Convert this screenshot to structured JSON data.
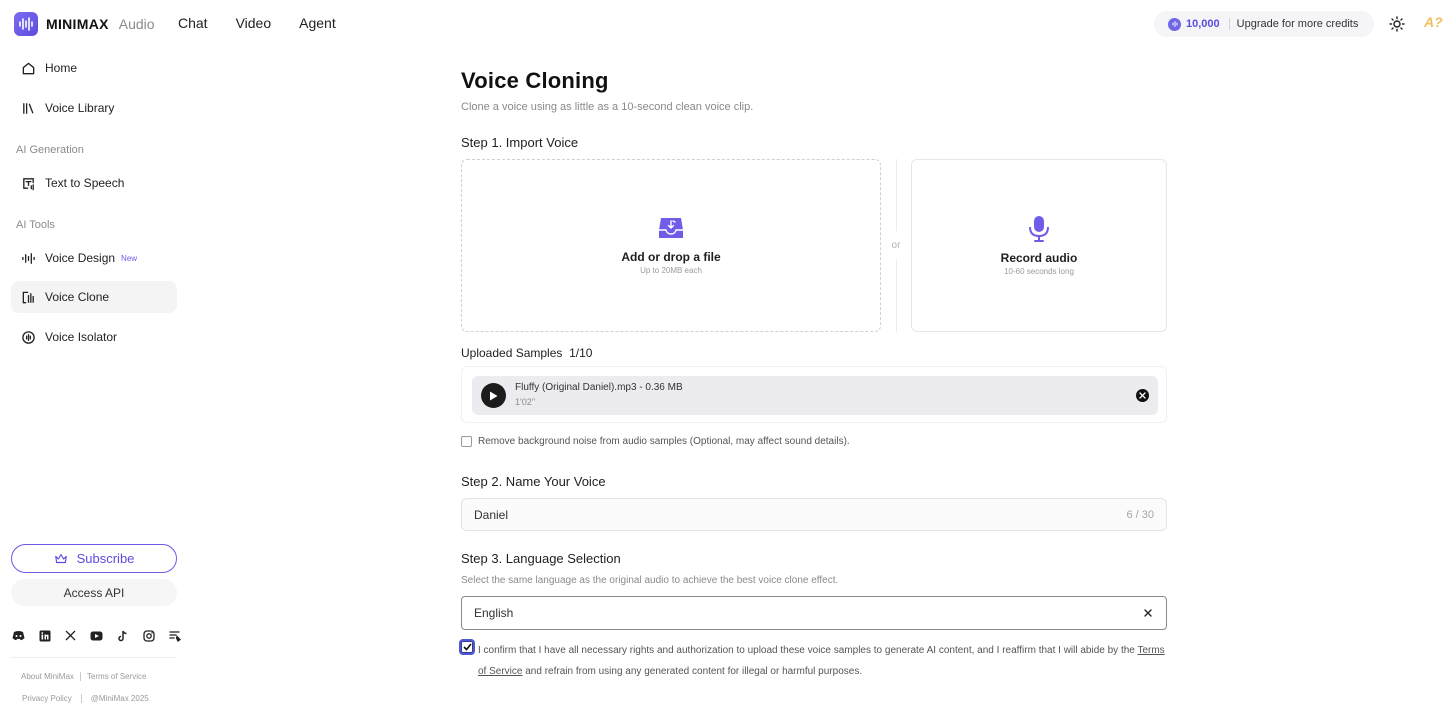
{
  "brand": {
    "name": "MINIMAX",
    "product": "Audio"
  },
  "topnav": [
    "Chat",
    "Video",
    "Agent"
  ],
  "credits": {
    "amount": "10,000",
    "upgrade_label": "Upgrade for more credits"
  },
  "avatar_text": "A?",
  "sidebar": {
    "items": [
      {
        "label": "Home",
        "icon": "home-icon"
      },
      {
        "label": "Voice Library",
        "icon": "library-icon"
      }
    ],
    "section_generation": "AI Generation",
    "generation_items": [
      {
        "label": "Text to Speech",
        "icon": "text-to-speech-icon"
      }
    ],
    "section_tools": "AI Tools",
    "tool_items": [
      {
        "label": "Voice Design",
        "icon": "waveform-icon",
        "badge": "New"
      },
      {
        "label": "Voice Clone",
        "icon": "voice-clone-icon",
        "active": true
      },
      {
        "label": "Voice Isolator",
        "icon": "voice-isolator-icon"
      }
    ],
    "subscribe_label": "Subscribe",
    "access_api_label": "Access API",
    "socials": [
      "discord-icon",
      "linkedin-icon",
      "x-icon",
      "youtube-icon",
      "tiktok-icon",
      "instagram-icon",
      "blog-icon"
    ],
    "footer": {
      "about": "About MiniMax",
      "terms": "Terms of Service",
      "privacy": "Privacy Policy",
      "copyright": "@MiniMax 2025"
    }
  },
  "main": {
    "title": "Voice Cloning",
    "subtitle": "Clone a voice using as little as a 10-second clean voice clip.",
    "step1": {
      "title": "Step 1. Import Voice",
      "upload_label": "Add or drop a file",
      "upload_sub": "Up to 20MB each",
      "or_text": "or",
      "record_label": "Record audio",
      "record_sub": "10-60 seconds long"
    },
    "samples": {
      "label": "Uploaded Samples",
      "count": "1/10",
      "items": [
        {
          "name": "Fluffy (Original Daniel).mp3 - 0.36 MB",
          "duration": "1'02''"
        }
      ]
    },
    "noise_option": "Remove background noise from audio samples (Optional, may affect sound details).",
    "step2": {
      "title": "Step 2. Name Your Voice",
      "value": "Daniel",
      "counter": "6 / 30"
    },
    "step3": {
      "title": "Step 3. Language Selection",
      "hint": "Select the same language as the original audio to achieve the best voice clone effect.",
      "value": "English"
    },
    "confirm": {
      "text_before": "I confirm that I have all necessary rights and authorization to upload these voice samples to generate AI content, and I reaffirm that I will abide by the ",
      "link": "Terms of Service",
      "text_after": " and refrain from using any generated content for illegal or harmful purposes.",
      "checked": true
    }
  },
  "colors": {
    "accent": "#5b4ce0",
    "accent_light": "#7b6cf0"
  }
}
